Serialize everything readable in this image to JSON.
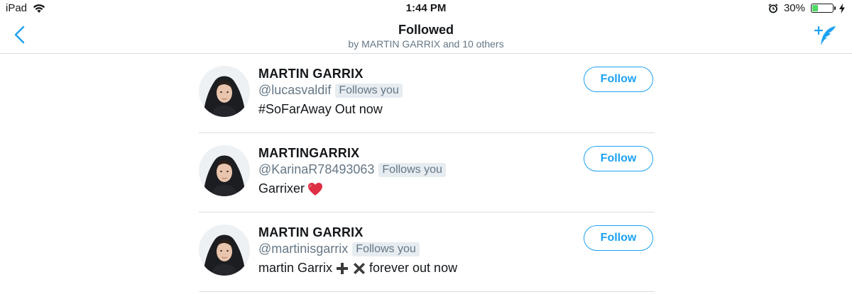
{
  "status_bar": {
    "device": "iPad",
    "time": "1:44 PM",
    "battery_percent": "30%",
    "battery_level": 0.3,
    "icons": [
      "wifi-icon",
      "alarm-icon",
      "battery-icon",
      "charging-icon"
    ]
  },
  "nav": {
    "title": "Followed",
    "subtitle": "by MARTIN GARRIX and 10 others",
    "back_icon": "chevron-left-icon",
    "compose_icon": "feather-plus-icon"
  },
  "colors": {
    "accent": "#1da1f2",
    "secondary_text": "#657786",
    "divider": "#d8dde1",
    "badge_bg": "#e6ecf0"
  },
  "users": [
    {
      "name": "MARTIN GARRIX",
      "handle": "@lucasvaldif",
      "badge": "Follows you",
      "bio": "#SoFarAway Out now",
      "button": "Follow"
    },
    {
      "name": "MARTINGARRIX",
      "handle": "@KarinaR78493063",
      "badge": "Follows you",
      "bio": "Garrixer",
      "bio_icons": [
        "heart-icon"
      ],
      "button": "Follow"
    },
    {
      "name": "MARTIN GARRIX",
      "handle": "@martinisgarrix",
      "badge": "Follows you",
      "bio_parts": [
        "martin Garrix",
        "forever out now"
      ],
      "bio_icons": [
        "plus-icon",
        "cross-icon"
      ],
      "button": "Follow"
    }
  ]
}
